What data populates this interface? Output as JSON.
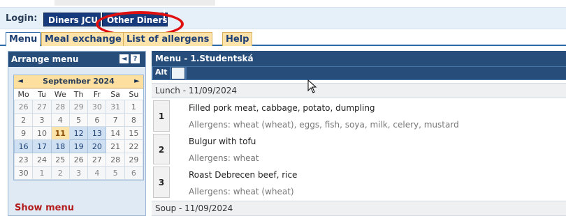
{
  "login": {
    "label": "Login:",
    "buttons": [
      "Diners JCU",
      "Other Diners"
    ]
  },
  "tabs": [
    "Menu",
    "Meal exchange",
    "List of allergens",
    "Help"
  ],
  "left_panel": {
    "title": "Arrange menu",
    "calendar": {
      "month": "September 2024",
      "prev": "◄",
      "next": "►",
      "weekdays": [
        "Mo",
        "Tu",
        "We",
        "Th",
        "Fr",
        "Sa",
        "Su"
      ],
      "weeks": [
        [
          "26",
          "27",
          "28",
          "29",
          "30",
          "31",
          "1"
        ],
        [
          "2",
          "3",
          "4",
          "5",
          "6",
          "7",
          "8"
        ],
        [
          "9",
          "10",
          "11",
          "12",
          "13",
          "14",
          "15"
        ],
        [
          "16",
          "17",
          "18",
          "19",
          "20",
          "21",
          "22"
        ],
        [
          "23",
          "24",
          "25",
          "26",
          "27",
          "28",
          "29"
        ],
        [
          "30",
          "1",
          "2",
          "3",
          "4",
          "5",
          "6"
        ]
      ],
      "selected_day": "11"
    },
    "show_menu": "Show menu"
  },
  "menu": {
    "title": "Menu - 1.Studentská",
    "alt_label": "Alt",
    "lunch_header": "Lunch - 11/09/2024",
    "items": [
      {
        "num": "1",
        "name": "Filled pork meat, cabbage, potato, dumpling",
        "allergens": "Allergens: wheat (wheat), eggs, fish, soya, milk, celery, mustard"
      },
      {
        "num": "2",
        "name": "Bulgur with tofu",
        "allergens": "Allergens: wheat"
      },
      {
        "num": "3",
        "name": "Roast Debrecen beef, rice",
        "allergens": "Allergens: wheat (wheat)"
      }
    ],
    "soup_header": "Soup - 11/09/2024"
  },
  "colors": {
    "accent": "#274d7b",
    "tab_bg": "#fde3a9",
    "highlight_circle": "#e01010",
    "show_menu": "#b31d1d"
  }
}
